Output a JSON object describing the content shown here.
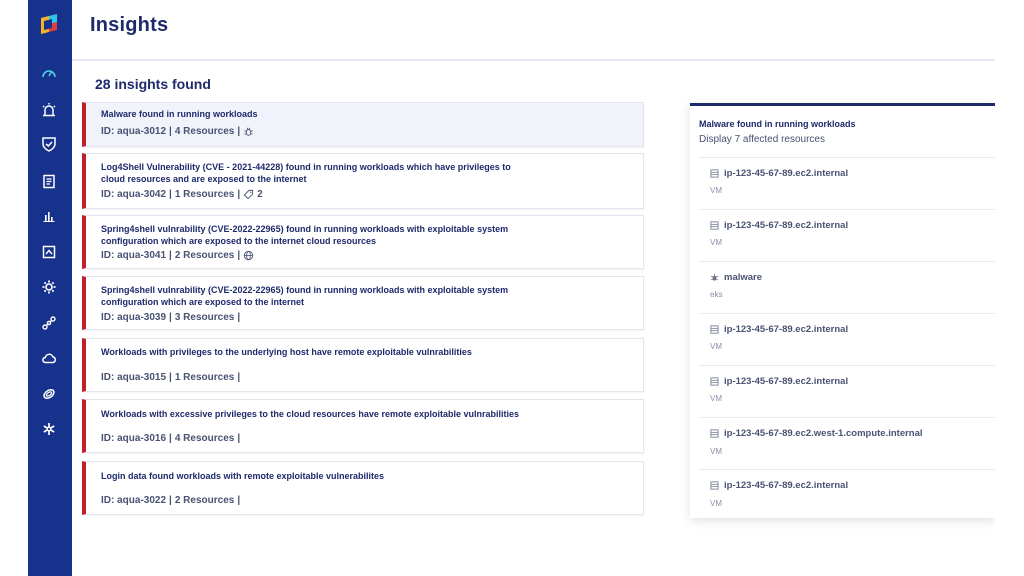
{
  "header": {
    "title": "Insights"
  },
  "summary": {
    "count_label": "28 insights found"
  },
  "sidebar": {
    "items": [
      {
        "name": "dashboard-icon",
        "active": true
      },
      {
        "name": "alarm-icon"
      },
      {
        "name": "shield-icon"
      },
      {
        "name": "clipboard-icon"
      },
      {
        "name": "bar-chart-icon"
      },
      {
        "name": "workload-icon"
      },
      {
        "name": "settings-cog-icon"
      },
      {
        "name": "network-nodes-icon"
      },
      {
        "name": "cloud-icon"
      },
      {
        "name": "shield-off-icon"
      },
      {
        "name": "integrations-icon"
      }
    ]
  },
  "insights": [
    {
      "title": "Malware found in running workloads",
      "id": "ID: aqua-3012",
      "resources": "4 Resources",
      "extra": "",
      "icon": "bug-icon",
      "selected": true
    },
    {
      "title": "Log4Shell Vulnerability (CVE - 2021-44228) found in running workloads which have privileges to cloud resources and are exposed to the internet",
      "id": "ID: aqua-3042",
      "resources": "1 Resources",
      "extra": "2",
      "icon": "tag-icon"
    },
    {
      "title": "Spring4shell vulnrability (CVE-2022-22965) found in running workloads with exploitable system configuration which are exposed to the internet cloud resources",
      "id": "ID: aqua-3041",
      "resources": "2 Resources",
      "extra": "",
      "icon": "globe-icon"
    },
    {
      "title": "Spring4shell vulnrability (CVE-2022-22965) found in running workloads with exploitable system configuration which are exposed to the internet",
      "id": "ID: aqua-3039",
      "resources": "3 Resources",
      "extra": "",
      "icon": ""
    },
    {
      "title": "Workloads with privileges to the underlying host have remote exploitable vulnrabilities",
      "id": "ID: aqua-3015",
      "resources": "1 Resources",
      "extra": "",
      "icon": ""
    },
    {
      "title": "Workloads with excessive privileges to the cloud resources have remote exploitable vulnrabilities",
      "id": "ID: aqua-3016",
      "resources": "4 Resources",
      "extra": "",
      "icon": ""
    },
    {
      "title": "Login data found workloads with remote exploitable vulnerabilites",
      "id": "ID: aqua-3022",
      "resources": "2 Resources",
      "extra": "",
      "icon": ""
    }
  ],
  "detail": {
    "title": "Malware found in running workloads",
    "subtitle": "Display 7 affected resources",
    "resources": [
      {
        "name": "ip-123-45-67-89.ec2.internal",
        "type": "VM",
        "icon": "server-icon"
      },
      {
        "name": "ip-123-45-67-89.ec2.internal",
        "type": "VM",
        "icon": "server-icon"
      },
      {
        "name": "malware",
        "type": "eks",
        "icon": "bug-icon"
      },
      {
        "name": "ip-123-45-67-89.ec2.internal",
        "type": "VM",
        "icon": "server-icon"
      },
      {
        "name": "ip-123-45-67-89.ec2.internal",
        "type": "VM",
        "icon": "server-icon"
      },
      {
        "name": "ip-123-45-67-89.ec2.west-1.compute.internal",
        "type": "VM",
        "icon": "server-icon"
      },
      {
        "name": "ip-123-45-67-89.ec2.internal",
        "type": "VM",
        "icon": "server-icon"
      }
    ]
  },
  "colors": {
    "sidebar": "#17328c",
    "accent": "#4fd1e8",
    "severity": "#c0202a",
    "title": "#1f2a6b"
  }
}
